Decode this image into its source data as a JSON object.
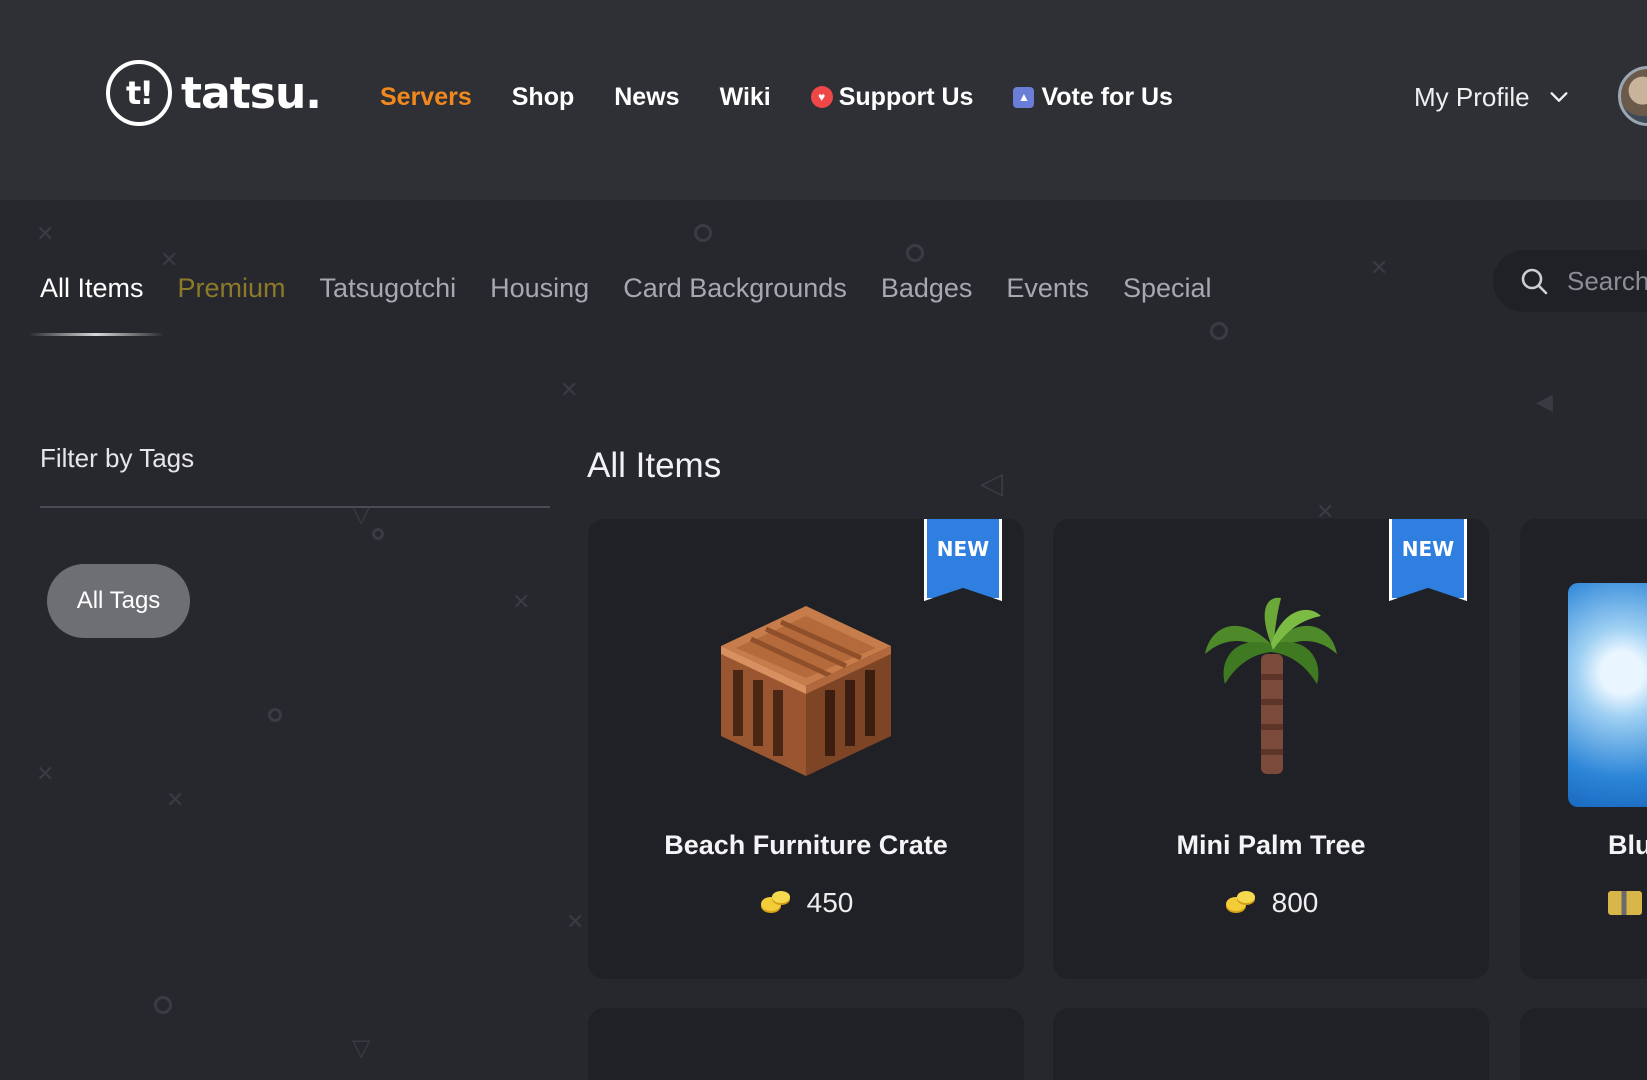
{
  "brand": {
    "mark": "t!",
    "name": "tatsu."
  },
  "nav": {
    "items": [
      {
        "label": "Servers",
        "active": true
      },
      {
        "label": "Shop"
      },
      {
        "label": "News"
      },
      {
        "label": "Wiki"
      },
      {
        "label": "Support Us",
        "icon": "heart-badge-icon"
      },
      {
        "label": "Vote for Us",
        "icon": "vote-arrow-icon"
      }
    ],
    "profile_label": "My Profile"
  },
  "tabs": [
    {
      "label": "All Items",
      "active": true
    },
    {
      "label": "Premium"
    },
    {
      "label": "Tatsugotchi"
    },
    {
      "label": "Housing"
    },
    {
      "label": "Card Backgrounds"
    },
    {
      "label": "Badges"
    },
    {
      "label": "Events"
    },
    {
      "label": "Special"
    }
  ],
  "search": {
    "placeholder": "Search"
  },
  "sidebar": {
    "title": "Filter by Tags",
    "tags": [
      {
        "label": "All Tags",
        "selected": true
      }
    ]
  },
  "main": {
    "title": "All Items",
    "items": [
      {
        "name": "Beach Furniture Crate",
        "price": "450",
        "badge": "NEW",
        "currency_icon": "gold-coins-icon"
      },
      {
        "name": "Mini Palm Tree",
        "price": "800",
        "badge": "NEW",
        "currency_icon": "gold-coins-icon"
      },
      {
        "name": "Blu",
        "currency_icon": "ticket-icon"
      }
    ]
  },
  "colors": {
    "accent": "#f2891e",
    "premium": "#8c7a2a",
    "new_badge": "#2f7fe0",
    "background": "#27282d",
    "card": "#202126"
  }
}
